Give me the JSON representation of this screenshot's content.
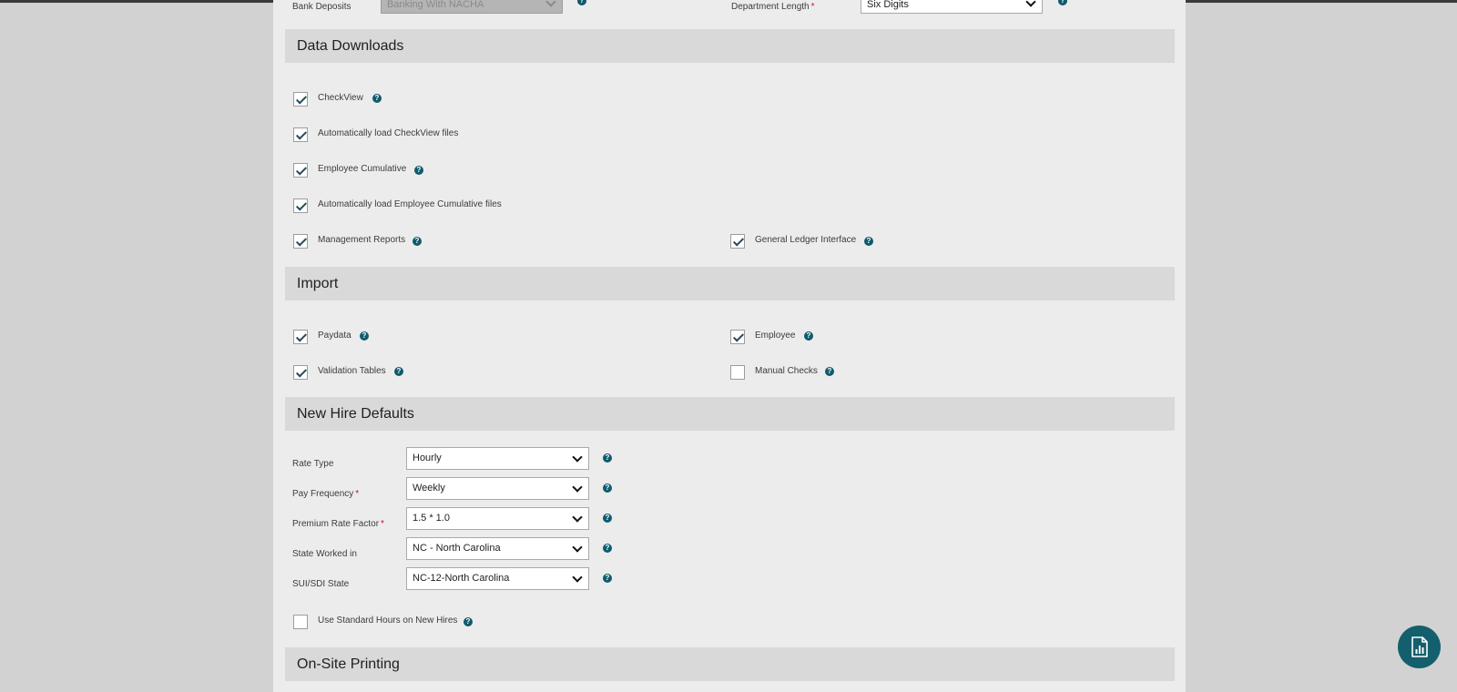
{
  "top_fields": {
    "bank_deposits_label": "Bank Deposits",
    "bank_deposits_value": "Banking With NACHA",
    "department_length_label": "Department Length",
    "department_length_required": "*",
    "department_length_value": "Six Digits"
  },
  "data_downloads": {
    "title": "Data Downloads",
    "checkview": "CheckView",
    "auto_checkview": "Automatically load CheckView files",
    "employee_cumulative": "Employee Cumulative",
    "auto_employee_cumulative": "Automatically load Employee Cumulative files",
    "management_reports": "Management Reports",
    "general_ledger": "General Ledger Interface"
  },
  "import": {
    "title": "Import",
    "paydata": "Paydata",
    "employee": "Employee",
    "validation_tables": "Validation Tables",
    "manual_checks": "Manual Checks"
  },
  "new_hire": {
    "title": "New Hire Defaults",
    "required_mark": "*",
    "rate_type_label": "Rate Type",
    "rate_type_value": "Hourly",
    "pay_frequency_label": "Pay Frequency",
    "pay_frequency_value": "Weekly",
    "premium_rate_label": "Premium Rate Factor",
    "premium_rate_value": "1.5 * 1.0",
    "state_worked_label": "State Worked in",
    "state_worked_value": "NC - North Carolina",
    "sui_sdi_label": "SUI/SDI State",
    "sui_sdi_value": "NC-12-North Carolina",
    "standard_hours": "Use Standard Hours on New Hires"
  },
  "onsite_printing": {
    "title": "On-Site Printing"
  },
  "help_glyph": "?",
  "colors": {
    "accent": "#135f6d",
    "check": "#214a5a",
    "panel": "#ececec",
    "section": "#d9d9d9",
    "required": "#c8102e"
  },
  "icons": {
    "help": "help-circle-icon",
    "fab": "report-document-icon"
  }
}
